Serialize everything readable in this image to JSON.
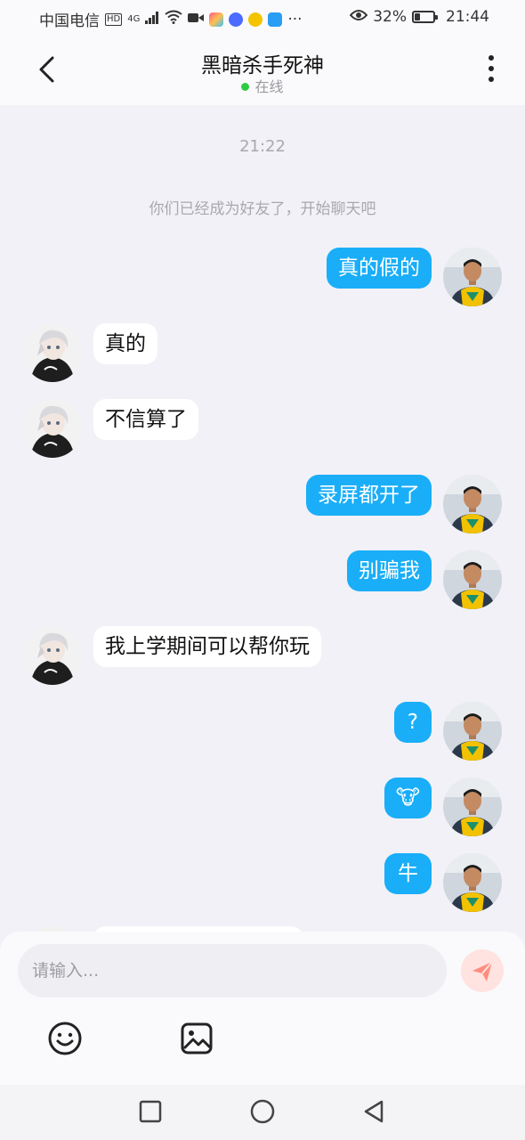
{
  "status_bar": {
    "carrier": "中国电信",
    "hd": "HD",
    "network": "4G",
    "more": "···",
    "battery_percent": "32%",
    "battery_level": 0.32,
    "time": "21:44"
  },
  "header": {
    "title": "黑暗杀手死神",
    "status": "在线"
  },
  "chat": {
    "timestamp": "21:22",
    "system_notice": "你们已经成为好友了，开始聊天吧",
    "messages": [
      {
        "from": "me",
        "text": "真的假的"
      },
      {
        "from": "other",
        "text": "真的"
      },
      {
        "from": "other",
        "text": "不信算了"
      },
      {
        "from": "me",
        "text": "录屏都开了"
      },
      {
        "from": "me",
        "text": "别骗我"
      },
      {
        "from": "other",
        "text": "我上学期间可以帮你玩"
      },
      {
        "from": "me",
        "text": "?"
      },
      {
        "from": "me",
        "text": "🐮"
      },
      {
        "from": "me",
        "text": "牛"
      }
    ]
  },
  "input": {
    "placeholder": "请输入..."
  },
  "colors": {
    "bubble_me": "#1aaef8",
    "bubble_other": "#ffffff",
    "online_dot": "#2ecc40",
    "send_button": "#ff8c80"
  },
  "icons": {
    "back": "chevron-left-icon",
    "more": "more-vertical-icon",
    "send": "paper-plane-icon",
    "emoji": "smiley-icon",
    "image": "image-icon"
  }
}
